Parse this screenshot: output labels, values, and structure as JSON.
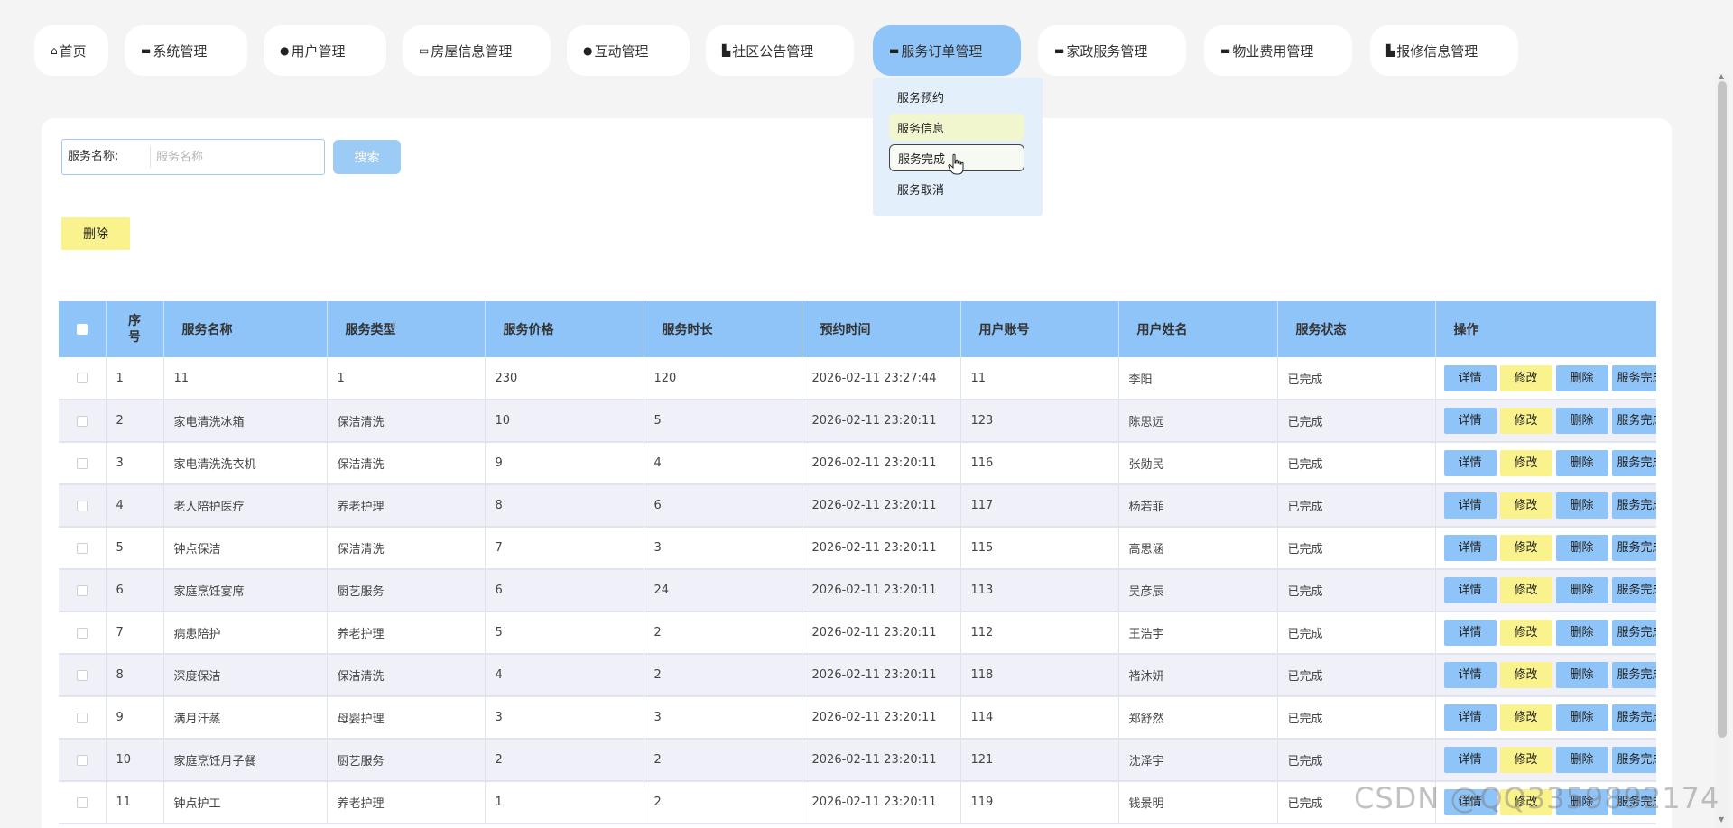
{
  "nav": {
    "items": [
      {
        "icon": "home-icon",
        "glyph": "⌂",
        "label": "首页"
      },
      {
        "icon": "system-icon",
        "glyph": "▬",
        "label": "系统管理"
      },
      {
        "icon": "user-icon",
        "glyph": "●",
        "label": "用户管理"
      },
      {
        "icon": "house-icon",
        "glyph": "▭",
        "label": "房屋信息管理"
      },
      {
        "icon": "drop-icon",
        "glyph": "●",
        "label": "互动管理"
      },
      {
        "icon": "building-icon",
        "glyph": "▙",
        "label": "社区公告管理"
      },
      {
        "icon": "order-icon",
        "glyph": "▬",
        "label": "服务订单管理"
      },
      {
        "icon": "home-service-icon",
        "glyph": "▬",
        "label": "家政服务管理"
      },
      {
        "icon": "fee-icon",
        "glyph": "▬",
        "label": "物业费用管理"
      },
      {
        "icon": "repair-icon",
        "glyph": "▙",
        "label": "报修信息管理"
      }
    ],
    "active_index": 6
  },
  "dropdown": {
    "items": [
      "服务预约",
      "服务信息",
      "服务完成",
      "服务取消"
    ]
  },
  "search": {
    "label": "服务名称:",
    "placeholder": "服务名称",
    "value": "",
    "button_label": "搜索"
  },
  "toolbar": {
    "delete_label": "删除"
  },
  "table": {
    "headers": [
      "",
      "序号",
      "服务名称",
      "服务类型",
      "服务价格",
      "服务时长",
      "预约时间",
      "用户账号",
      "用户姓名",
      "服务状态",
      "操作"
    ],
    "actions": [
      "详情",
      "修改",
      "删除",
      "服务完成"
    ],
    "rows": [
      [
        "1",
        "11",
        "1",
        "230",
        "120",
        "2026-02-11 23:27:44",
        "11",
        "李阳",
        "已完成"
      ],
      [
        "2",
        "家电清洗冰箱",
        "保洁清洗",
        "10",
        "5",
        "2026-02-11 23:20:11",
        "123",
        "陈思远",
        "已完成"
      ],
      [
        "3",
        "家电清洗洗衣机",
        "保洁清洗",
        "9",
        "4",
        "2026-02-11 23:20:11",
        "116",
        "张勋民",
        "已完成"
      ],
      [
        "4",
        "老人陪护医疗",
        "养老护理",
        "8",
        "6",
        "2026-02-11 23:20:11",
        "117",
        "杨若菲",
        "已完成"
      ],
      [
        "5",
        "钟点保洁",
        "保洁清洗",
        "7",
        "3",
        "2026-02-11 23:20:11",
        "115",
        "高思涵",
        "已完成"
      ],
      [
        "6",
        "家庭烹饪宴席",
        "厨艺服务",
        "6",
        "24",
        "2026-02-11 23:20:11",
        "113",
        "吴彦辰",
        "已完成"
      ],
      [
        "7",
        "病患陪护",
        "养老护理",
        "5",
        "2",
        "2026-02-11 23:20:11",
        "112",
        "王浩宇",
        "已完成"
      ],
      [
        "8",
        "深度保洁",
        "保洁清洗",
        "4",
        "2",
        "2026-02-11 23:20:11",
        "118",
        "褚沐妍",
        "已完成"
      ],
      [
        "9",
        "满月汗蒸",
        "母婴护理",
        "3",
        "3",
        "2026-02-11 23:20:11",
        "114",
        "郑舒然",
        "已完成"
      ],
      [
        "10",
        "家庭烹饪月子餐",
        "厨艺服务",
        "2",
        "2",
        "2026-02-11 23:20:11",
        "121",
        "沈泽宇",
        "已完成"
      ],
      [
        "11",
        "钟点护工",
        "养老护理",
        "1",
        "2",
        "2026-02-11 23:20:11",
        "119",
        "钱景明",
        "已完成"
      ]
    ]
  },
  "watermark": "CSDN @QQ3359892174",
  "colors": {
    "accent_blue": "#8fc4f8",
    "accent_yellow": "#faf28c",
    "background": "#f4f4f4"
  }
}
